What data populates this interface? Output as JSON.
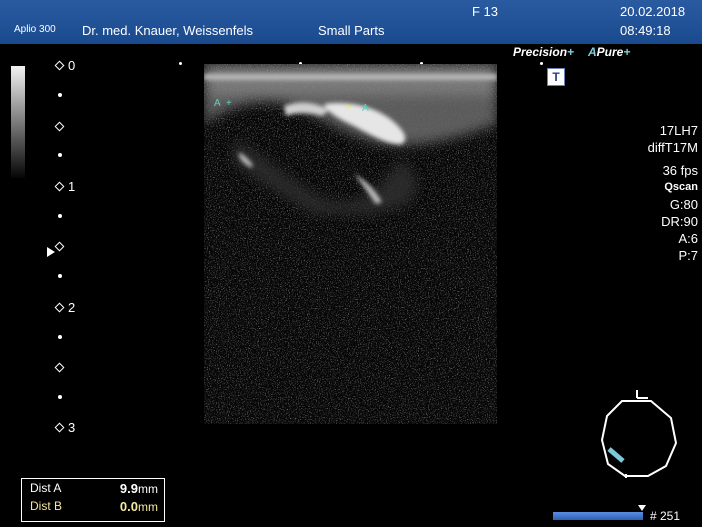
{
  "header": {
    "model": "Aplio 300",
    "institution": "Dr. med. Knauer, Weissenfels",
    "preset": "Small Parts",
    "frequency": "F 13",
    "date": "20.02.2018",
    "time": "08:49:18"
  },
  "logos": {
    "precision": "Precision",
    "pure_prefix": "A",
    "pure": "Pure",
    "plus": "+"
  },
  "thi_button": "T",
  "depth_labels": [
    "0",
    "1",
    "2",
    "3"
  ],
  "params": {
    "probe": "17LH7",
    "mode": "diffT17M",
    "fps": "36 fps",
    "qscan": "Qscan",
    "gain": "G:80",
    "dr": "DR:90",
    "a": "A:6",
    "p": "P:7"
  },
  "calipers": {
    "a_marker": "A",
    "cross": "+"
  },
  "measurements": {
    "dist_a_label": "Dist A",
    "dist_a_value": "9.9",
    "dist_a_unit": "mm",
    "dist_b_label": "Dist B",
    "dist_b_value": "0.0",
    "dist_b_unit": "mm"
  },
  "frame_counter": "# 251",
  "colors": {
    "header_bg": "#1a4a8e",
    "accent": "#7fd0e0",
    "dist_b": "#f5e6a0",
    "caliper": "#5fd0c0"
  }
}
